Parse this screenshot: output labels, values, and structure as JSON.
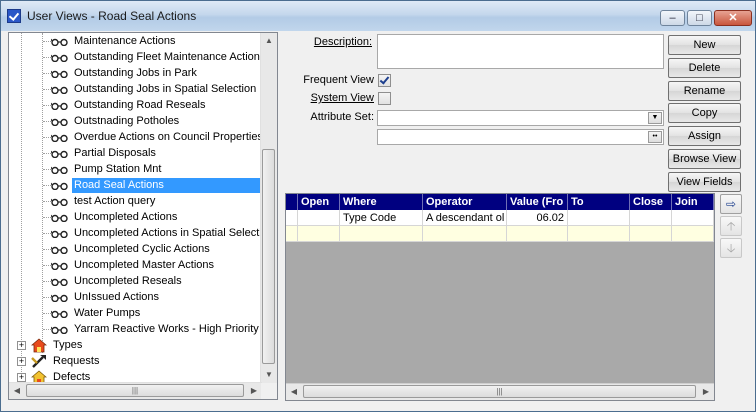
{
  "window": {
    "title": "User Views - Road Seal Actions"
  },
  "tree": {
    "leaf_items": [
      "Maintenance Actions",
      "Outstanding Fleet Maintenance Actions",
      "Outstanding Jobs in Park",
      "Outstanding Jobs in Spatial Selection",
      "Outstanding Road Reseals",
      "Outstnading Potholes",
      "Overdue Actions on Council Properties",
      "Partial Disposals",
      "Pump Station Mnt",
      "Road Seal Actions",
      "test Action query",
      "Uncompleted Actions",
      "Uncompleted Actions in Spatial Selection",
      "Uncompleted Cyclic Actions",
      "Uncompleted Master Actions",
      "Uncompleted Reseals",
      "UnIssued Actions",
      "Water Pumps",
      "Yarram Reactive Works - High Priority"
    ],
    "selected_item": "Road Seal Actions",
    "top_items": [
      "Types",
      "Requests",
      "Defects"
    ]
  },
  "form": {
    "description_label": "Description:",
    "description_value": "",
    "frequent_view_label": "Frequent View",
    "frequent_view_checked": true,
    "system_view_label": "System View",
    "system_view_checked": false,
    "attribute_set_label": "Attribute Set:",
    "attribute_set_value": "",
    "attribute_set_second_value": ""
  },
  "buttons": {
    "new": "New",
    "delete": "Delete",
    "rename": "Rename",
    "copy": "Copy",
    "assign": "Assign",
    "browse_view": "Browse View",
    "view_fields": "View Fields"
  },
  "grid": {
    "columns": [
      "Open",
      "Where",
      "Operator",
      "Value (Fro",
      "To",
      "Close",
      "Join"
    ],
    "rows": [
      [
        "",
        "Type Code",
        "A descendant ol",
        "06.02",
        "",
        "",
        ""
      ]
    ]
  },
  "colors": {
    "grid_header": "#000080",
    "selection": "#3399ff",
    "new_row": "#ffffe1"
  }
}
